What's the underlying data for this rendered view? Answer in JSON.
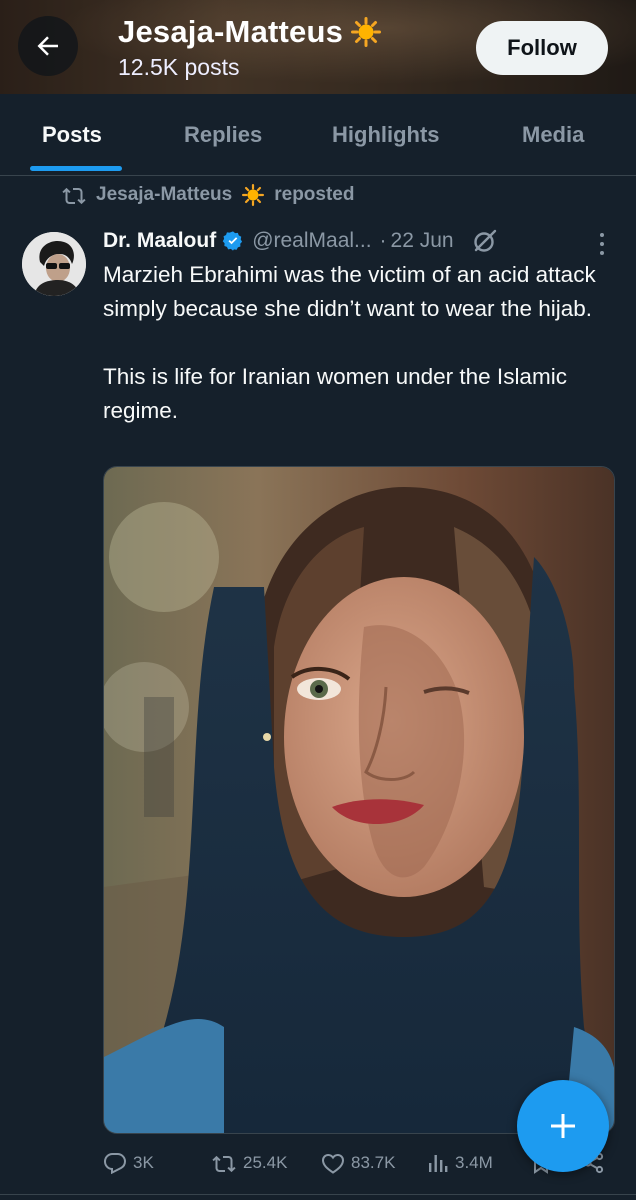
{
  "header": {
    "name": "Jesaja-Matteus",
    "name_emoji": "sun-emoji",
    "post_count": "12.5K posts",
    "follow_label": "Follow"
  },
  "tabs": [
    {
      "label": "Posts",
      "active": true
    },
    {
      "label": "Replies",
      "active": false
    },
    {
      "label": "Highlights",
      "active": false
    },
    {
      "label": "Media",
      "active": false
    }
  ],
  "repost": {
    "name": "Jesaja-Matteus",
    "suffix": "reposted"
  },
  "post": {
    "author": "Dr. Maalouf",
    "verified": true,
    "handle": "@realMaal...",
    "separator": "·",
    "date": "22 Jun",
    "text": "Marzieh Ebrahimi was the victim of an acid attack simply because she didn’t want to wear the hijab.\n\nThis is life for Iranian women under the Islamic regime.",
    "replies": "3K",
    "reposts": "25.4K",
    "likes": "83.7K",
    "views": "3.4M"
  },
  "colors": {
    "background": "#15202b",
    "accent": "#1d9bf0",
    "muted": "#8b98a5",
    "text": "#f7f9f9",
    "border": "#38444d"
  },
  "icons": [
    "back-arrow-icon",
    "sun-icon",
    "repost-icon",
    "verified-badge-icon",
    "grok-icon",
    "more-icon",
    "reply-icon",
    "like-icon",
    "views-icon",
    "bookmark-icon",
    "share-icon",
    "plus-icon"
  ]
}
